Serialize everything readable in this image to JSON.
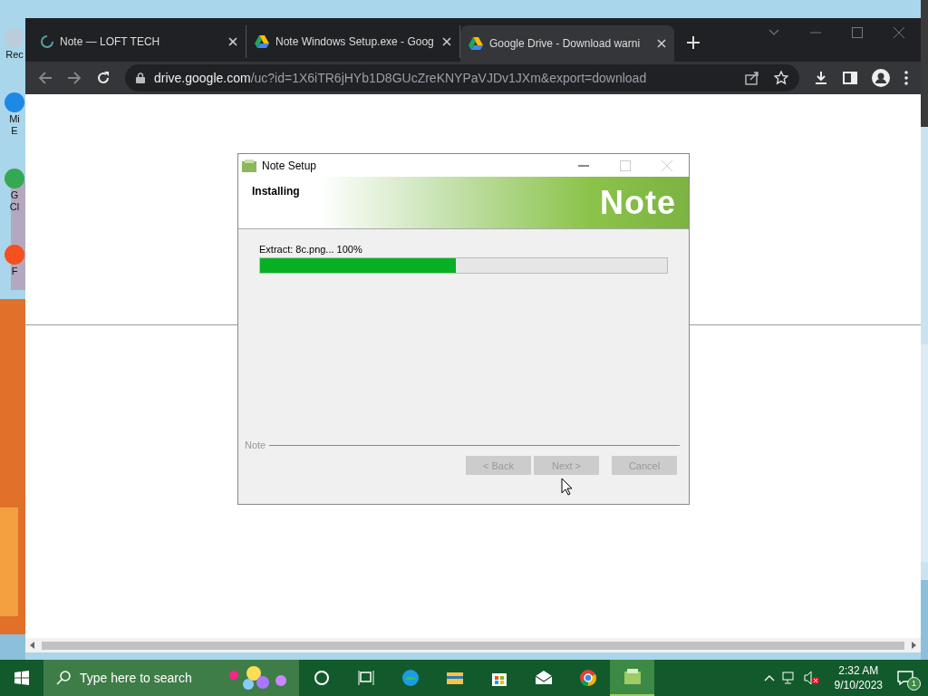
{
  "desktop": {
    "icons": [
      {
        "lines": [
          "Rec"
        ]
      },
      {
        "lines": [
          "Mi",
          "E"
        ]
      },
      {
        "lines": [
          "G",
          "Cl"
        ]
      },
      {
        "lines": [
          "F"
        ]
      }
    ]
  },
  "browser": {
    "tabs": [
      {
        "title": "Note — LOFT TECH",
        "kind": "spinner",
        "selected": false
      },
      {
        "title": "Note Windows Setup.exe - Goog",
        "kind": "drive",
        "selected": false
      },
      {
        "title": "Google Drive - Download warni",
        "kind": "drive",
        "selected": true
      }
    ],
    "address": {
      "host": "drive.google.com",
      "path": "/uc?id=1X6iTR6jHYb1D8GUcZreKNYPaVJDv1JXm&export=download"
    }
  },
  "dialog": {
    "title": "Note Setup",
    "heading": "Installing",
    "brand": "Note",
    "status": "Extract: 8c.png... 100%",
    "progress": {
      "level": 0.48
    },
    "footer_label": "Note",
    "buttons": [
      {
        "label": "< Back",
        "disabled": true
      },
      {
        "label": "Next >",
        "disabled": true
      },
      {
        "label": "Cancel",
        "disabled": true
      }
    ]
  },
  "taskbar": {
    "search": {
      "placeholder": "Type here to search"
    },
    "apps": [
      {
        "kind": "cortana",
        "selected": false
      },
      {
        "kind": "taskview",
        "selected": false
      },
      {
        "kind": "edge",
        "selected": false
      },
      {
        "kind": "explorer",
        "selected": false
      },
      {
        "kind": "store",
        "selected": false
      },
      {
        "kind": "mail",
        "selected": false
      },
      {
        "kind": "chrome",
        "selected": false
      },
      {
        "kind": "note",
        "selected": true
      }
    ],
    "time": "2:32 AM",
    "date": "9/10/2023",
    "notifications": "1"
  }
}
